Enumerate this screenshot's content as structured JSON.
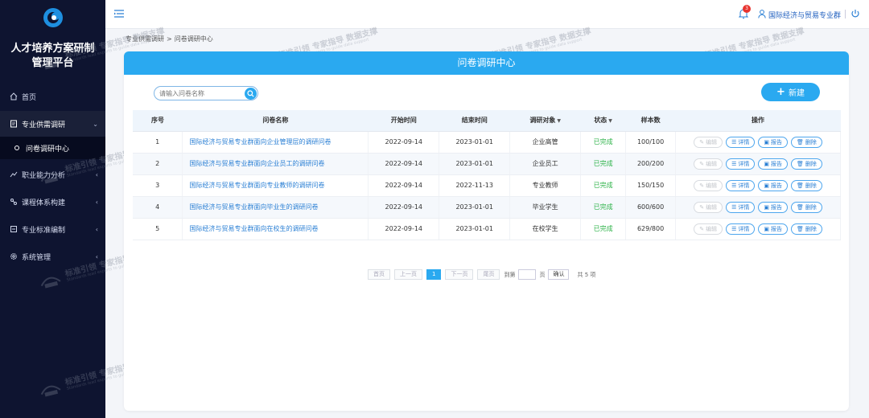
{
  "app": {
    "title_line1": "人才培养方案研制",
    "title_line2": "管理平台"
  },
  "sidebar": {
    "items": [
      {
        "label": "首页",
        "icon": "home-icon"
      },
      {
        "label": "专业供需调研",
        "icon": "survey-icon"
      },
      {
        "label": "问卷调研中心",
        "icon": "circle-icon"
      },
      {
        "label": "职业能力分析",
        "icon": "analysis-icon"
      },
      {
        "label": "课程体系构建",
        "icon": "course-icon"
      },
      {
        "label": "专业标准编制",
        "icon": "standard-icon"
      },
      {
        "label": "系统管理",
        "icon": "gear-icon"
      }
    ]
  },
  "topbar": {
    "notification_count": "3",
    "user_name": "国际经济与贸易专业群"
  },
  "breadcrumb": {
    "parent": "专业供需调研",
    "separator": ">",
    "current": "问卷调研中心"
  },
  "panel": {
    "title": "问卷调研中心"
  },
  "search": {
    "placeholder": "请输入问卷名称"
  },
  "toolbar": {
    "new_label": "新建"
  },
  "table": {
    "headers": [
      "序号",
      "问卷名称",
      "开始时间",
      "结束时间",
      "调研对象",
      "状态",
      "样本数",
      "操作"
    ],
    "rows": [
      {
        "no": "1",
        "name": "国际经济与贸易专业群面向企业管理层的调研问卷",
        "start": "2022-09-14",
        "end": "2023-01-01",
        "target": "企业高管",
        "status": "已完成",
        "samples": "100/100"
      },
      {
        "no": "2",
        "name": "国际经济与贸易专业群面向企业员工的调研问卷",
        "start": "2022-09-14",
        "end": "2023-01-01",
        "target": "企业员工",
        "status": "已完成",
        "samples": "200/200"
      },
      {
        "no": "3",
        "name": "国际经济与贸易专业群面向专业教师的调研问卷",
        "start": "2022-09-14",
        "end": "2022-11-13",
        "target": "专业教师",
        "status": "已完成",
        "samples": "150/150"
      },
      {
        "no": "4",
        "name": "国际经济与贸易专业群面向毕业生的调研问卷",
        "start": "2022-09-14",
        "end": "2023-01-01",
        "target": "毕业学生",
        "status": "已完成",
        "samples": "600/600"
      },
      {
        "no": "5",
        "name": "国际经济与贸易专业群面向在校生的调研问卷",
        "start": "2022-09-14",
        "end": "2023-01-01",
        "target": "在校学生",
        "status": "已完成",
        "samples": "629/800"
      }
    ],
    "actions": {
      "edit": "编辑",
      "detail": "详情",
      "report": "报告",
      "delete": "删除"
    }
  },
  "pagination": {
    "first": "首页",
    "prev": "上一页",
    "current": "1",
    "next": "下一页",
    "last": "尾页",
    "goto_prefix": "到第",
    "goto_suffix": "页",
    "confirm": "确认",
    "total": "共 5 项"
  },
  "watermark": {
    "line1": "标准引领 专家指导 数据支撑",
    "line2": "Standards lead experts to guide data support"
  },
  "colors": {
    "accent": "#2aa9f0",
    "sidebar_bg": "#0e1430",
    "status_done": "#2fb34a",
    "badge": "#e8342f"
  }
}
